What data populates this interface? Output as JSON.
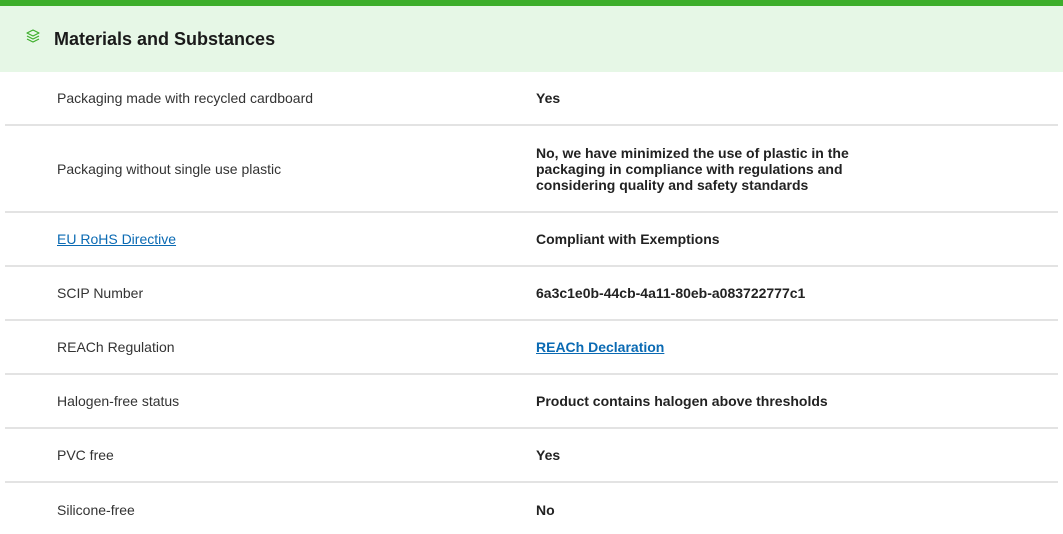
{
  "section": {
    "title": "Materials and Substances",
    "icon": "layers-icon",
    "accent_color": "#3dae2b",
    "header_bg": "#e6f7e6"
  },
  "rows": [
    {
      "label": "Packaging made with recycled cardboard",
      "value": "Yes"
    },
    {
      "label": "Packaging without single use plastic",
      "value": "No, we have minimized the use of plastic in the packaging in compliance with regulations and considering quality and safety standards"
    },
    {
      "label": "EU RoHS Directive",
      "value": "Compliant with Exemptions"
    },
    {
      "label": "SCIP Number",
      "value": "6a3c1e0b-44cb-4a11-80eb-a083722777c1"
    },
    {
      "label": "REACh Regulation",
      "value": "REACh Declaration"
    },
    {
      "label": "Halogen-free status",
      "value": "Product contains halogen above thresholds"
    },
    {
      "label": "PVC free",
      "value": "Yes"
    },
    {
      "label": "Silicone-free",
      "value": "No"
    }
  ]
}
